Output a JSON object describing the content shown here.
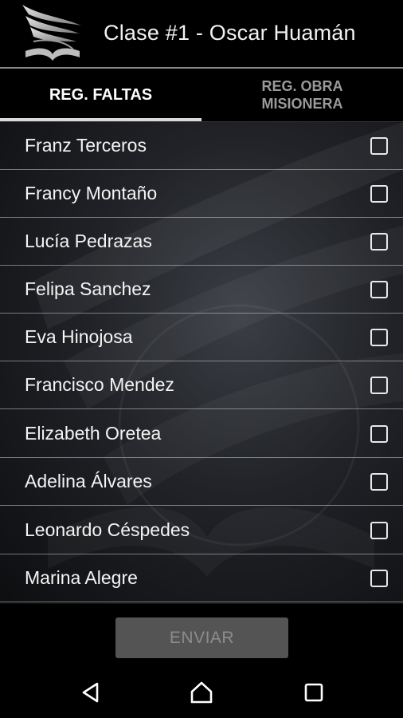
{
  "app": {
    "title": "Clase #1 - Oscar Huamán",
    "logo_icon": "winged-book-logo-icon"
  },
  "tabs": [
    {
      "label": "REG. FALTAS",
      "active": true
    },
    {
      "label_line1": "REG. OBRA",
      "label_line2": "MISIONERA",
      "active": false
    }
  ],
  "students": [
    {
      "name": "Franz Terceros",
      "checked": false
    },
    {
      "name": "Francy Montaño",
      "checked": false
    },
    {
      "name": "Lucía Pedrazas",
      "checked": false
    },
    {
      "name": "Felipa Sanchez",
      "checked": false
    },
    {
      "name": "Eva Hinojosa",
      "checked": false
    },
    {
      "name": "Francisco Mendez",
      "checked": false
    },
    {
      "name": "Elizabeth Oretea",
      "checked": false
    },
    {
      "name": "Adelina Álvares",
      "checked": false
    },
    {
      "name": "Leonardo Céspedes",
      "checked": false
    },
    {
      "name": "Marina Alegre",
      "checked": false
    }
  ],
  "actions": {
    "send_label": "ENVIAR",
    "send_enabled": false
  },
  "navbar": {
    "back_icon": "back-triangle-icon",
    "home_icon": "home-icon",
    "recents_icon": "recents-square-icon"
  },
  "colors": {
    "background": "#000000",
    "tab_indicator": "#d9d9d9",
    "button_disabled_bg": "#545454",
    "button_disabled_text": "#8c8c8c"
  }
}
